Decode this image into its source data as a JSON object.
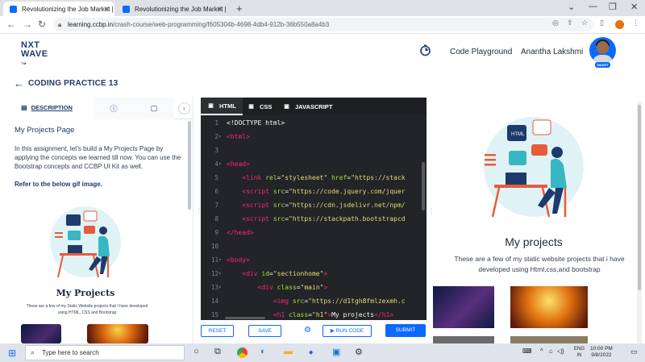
{
  "browser": {
    "tabs": [
      {
        "title": "Revolutionizing the Job Market |",
        "active": true
      },
      {
        "title": "Revolutionizing the Job Market |",
        "active": false
      }
    ],
    "new_tab": "+",
    "url_host": "learning.ccbp.in",
    "url_path": "/crash-course/web-programming/f605304b-4698-4db4-912b-36b550a8a4b3"
  },
  "header": {
    "logo_line1": "NXT",
    "logo_line2": "WAVE",
    "logo_tm": "TM",
    "code_playground": "Code Playground",
    "user_name": "Anantha Lakshmi",
    "badge": "SMART"
  },
  "page": {
    "title": "CODING PRACTICE 13"
  },
  "left_panel": {
    "tab_description": "DESCRIPTION",
    "heading": "My Projects Page",
    "text": "In this assignment, let's build a My Projects Page by applying the concepts we learned till now. You can use the Bootstrap concepts and CCBP UI Kit as well.",
    "ref": "Refer to the below gif image.",
    "gif_title": "My Projects",
    "gif_sub": "These are a few of my Static Website projects that I have developed using HTML, CSS and Bootstrap"
  },
  "editor": {
    "tabs": [
      "HTML",
      "CSS",
      "JAVASCRIPT"
    ],
    "lines": [
      {
        "n": "1",
        "fold": "",
        "html": "<span>&lt;!DOCTYPE html&gt;</span>"
      },
      {
        "n": "2",
        "fold": "▾",
        "html": "<span class='tg'>&lt;html&gt;</span>"
      },
      {
        "n": "3",
        "fold": "",
        "html": ""
      },
      {
        "n": "4",
        "fold": "▾",
        "html": "<span class='tg'>&lt;head&gt;</span>"
      },
      {
        "n": "5",
        "fold": "",
        "html": "&nbsp;&nbsp;&nbsp;&nbsp;<span class='tg'>&lt;link</span> <span class='at'>rel</span>=<span class='st'>\"stylesheet\"</span> <span class='at'>href</span>=<span class='st'>\"https://stack</span>"
      },
      {
        "n": "6",
        "fold": "",
        "html": "&nbsp;&nbsp;&nbsp;&nbsp;<span class='tg'>&lt;script</span> <span class='at'>src</span>=<span class='st'>\"https://code.jquery.com/jquer</span>"
      },
      {
        "n": "7",
        "fold": "",
        "html": "&nbsp;&nbsp;&nbsp;&nbsp;<span class='tg'>&lt;script</span> <span class='at'>src</span>=<span class='st'>\"https://cdn.jsdelivr.net/npm/</span>"
      },
      {
        "n": "8",
        "fold": "",
        "html": "&nbsp;&nbsp;&nbsp;&nbsp;<span class='tg'>&lt;script</span> <span class='at'>src</span>=<span class='st'>\"https://stackpath.bootstrapcd</span>"
      },
      {
        "n": "9",
        "fold": "",
        "html": "<span class='tg'>&lt;/head&gt;</span>"
      },
      {
        "n": "10",
        "fold": "",
        "html": ""
      },
      {
        "n": "11",
        "fold": "▾",
        "html": "<span class='tg'>&lt;body&gt;</span>"
      },
      {
        "n": "12",
        "fold": "▾",
        "html": "&nbsp;&nbsp;&nbsp;&nbsp;<span class='tg'>&lt;div</span> <span class='at'>id</span>=<span class='st'>\"sectionhome\"</span><span class='tg'>&gt;</span>"
      },
      {
        "n": "13",
        "fold": "▾",
        "html": "&nbsp;&nbsp;&nbsp;&nbsp;&nbsp;&nbsp;&nbsp;&nbsp;<span class='tg'>&lt;div</span> <span class='at'>class</span>=<span class='st'>\"main\"</span><span class='tg'>&gt;</span>"
      },
      {
        "n": "14",
        "fold": "",
        "html": "&nbsp;&nbsp;&nbsp;&nbsp;&nbsp;&nbsp;&nbsp;&nbsp;&nbsp;&nbsp;&nbsp;&nbsp;<span class='tg'>&lt;img</span> <span class='at'>src</span>=<span class='st'>\"https://d1tgh8fmlzexmh.c</span>"
      },
      {
        "n": "15",
        "fold": "",
        "html": "&nbsp;&nbsp;&nbsp;&nbsp;&nbsp;&nbsp;&nbsp;&nbsp;&nbsp;&nbsp;&nbsp;&nbsp;<span class='tg'>&lt;h1</span> <span class='at'>class</span>=<span class='st'>\"h1\"</span><span class='tg'>&gt;</span>My projects<span class='tg'>&lt;/h1&gt;</span>"
      }
    ],
    "reset_label": "RESET",
    "save_label": "SAVE",
    "run_label": "RUN CODE",
    "submit_label": "SUBMIT"
  },
  "preview": {
    "title": "My projects",
    "subtitle": "These are a few of my static website projects that i have developed using Html,css,and bootstrap"
  },
  "taskbar": {
    "search_placeholder": "Type here to search",
    "lang1": "ENG",
    "lang2": "IN",
    "time": "10:00 PM",
    "date": "9/8/2022"
  },
  "colors": {
    "brand_blue": "#0b69ff",
    "title_navy": "#1e3a6d",
    "editor_bg": "#222428"
  }
}
